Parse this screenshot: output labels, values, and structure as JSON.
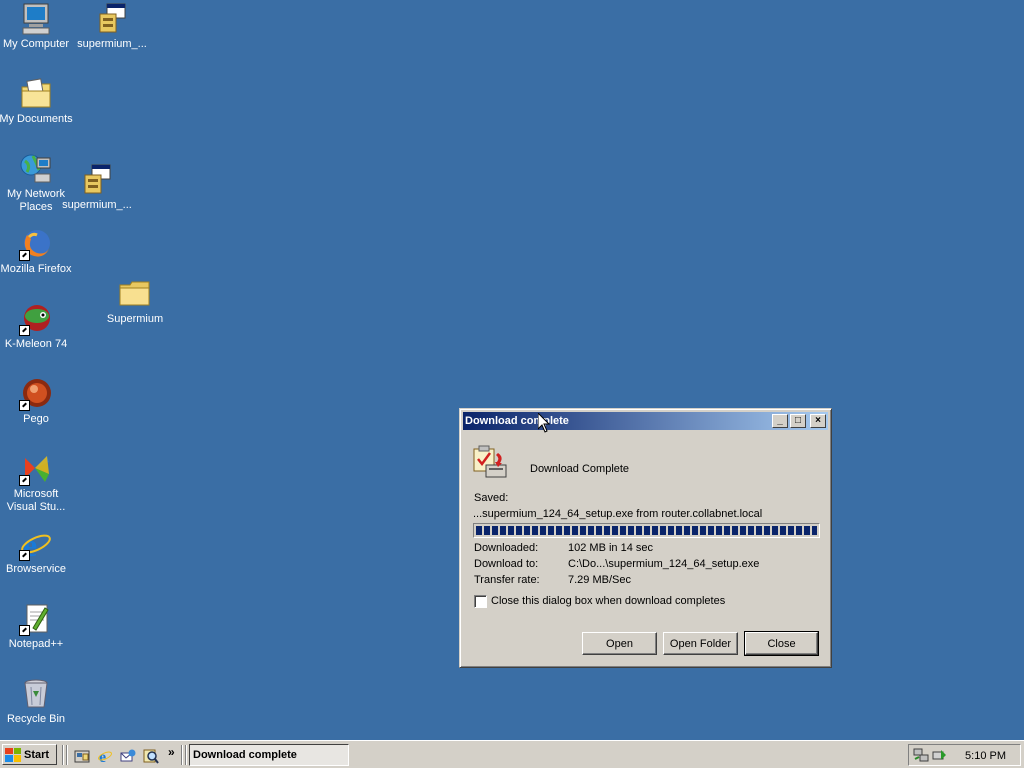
{
  "desktop": {
    "icons": {
      "my_computer": "My Computer",
      "supermium_1": "supermium_...",
      "my_documents": "My Documents",
      "my_network_places": "My Network Places",
      "supermium_2": "supermium_...",
      "mozilla_firefox": "Mozilla Firefox",
      "supermium_folder": "Supermium",
      "k_meleon": "K-Meleon 74",
      "pego": "Pego",
      "microsoft_visual_studio": "Microsoft Visual Stu...",
      "browservice": "Browservice",
      "notepad_pp": "Notepad++",
      "recycle_bin": "Recycle Bin"
    }
  },
  "dialog": {
    "title": "Download complete",
    "heading": "Download Complete",
    "saved_label": "Saved:",
    "saved_value": "...supermium_124_64_setup.exe from router.collabnet.local",
    "progress_fraction": 1.0,
    "downloaded_label": "Downloaded:",
    "downloaded_value": "102 MB in 14 sec",
    "download_to_label": "Download to:",
    "download_to_value": "C:\\Do...\\supermium_124_64_setup.exe",
    "transfer_rate_label": "Transfer rate:",
    "transfer_rate_value": "7.29 MB/Sec",
    "close_checkbox_label": "Close this dialog box when download completes",
    "close_checkbox_checked": false,
    "buttons": {
      "open": "Open",
      "open_folder": "Open Folder",
      "close": "Close"
    },
    "title_buttons": {
      "minimize": "_",
      "maximize": "□",
      "close": "×"
    }
  },
  "taskbar": {
    "start_label": "Start",
    "quick_launch_more": "»",
    "active_task": "Download complete",
    "clock": "5:10 PM"
  }
}
